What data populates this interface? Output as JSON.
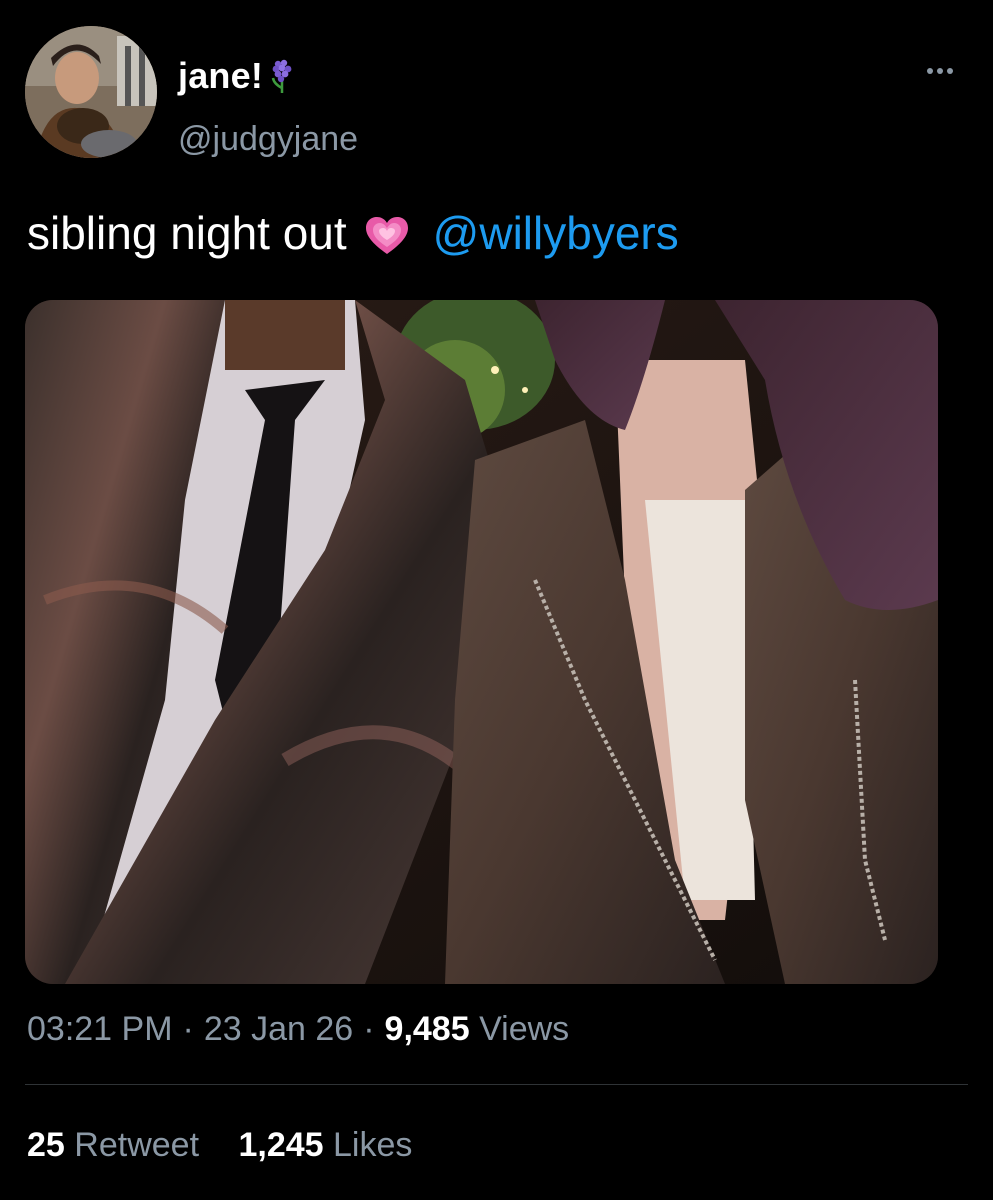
{
  "tweet": {
    "author": {
      "display_name": "jane!",
      "name_emoji": "hyacinth-icon",
      "handle": "@judgyjane",
      "avatar": "profile-photo"
    },
    "more_icon": "more-horizontal-icon",
    "text": "sibling night out",
    "text_emoji": "growing-heart-icon",
    "mention": "@willybyers",
    "media": "photo-two-people-leather-jackets",
    "time": "03:21 PM",
    "separator": "·",
    "date": "23 Jan 26",
    "views_count": "9,485",
    "views_label": "Views",
    "retweets_count": "25",
    "retweets_label": "Retweet",
    "likes_count": "1,245",
    "likes_label": "Likes"
  },
  "colors": {
    "background": "#000000",
    "primary_text": "#ffffff",
    "secondary_text": "#8b98a5",
    "link": "#1d9bf0",
    "divider": "#2f3336"
  }
}
